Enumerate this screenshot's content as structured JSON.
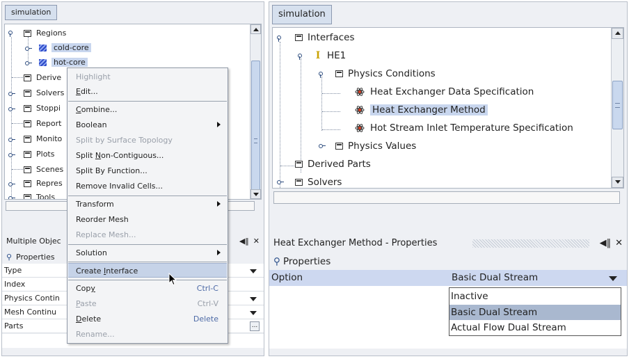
{
  "left": {
    "tab_label": "simulation",
    "tree": [
      {
        "label": "Regions",
        "icon": "folder-icon"
      },
      {
        "label": "cold-core",
        "icon": "region-icon"
      },
      {
        "label": "hot-core",
        "icon": "region-icon"
      },
      {
        "label": "Derive",
        "icon": "folder-icon"
      },
      {
        "label": "Solvers",
        "icon": "folder-icon"
      },
      {
        "label": "Stoppi",
        "icon": "folder-icon"
      },
      {
        "label": "Report",
        "icon": "folder-icon"
      },
      {
        "label": "Monito",
        "icon": "folder-icon"
      },
      {
        "label": "Plots",
        "icon": "folder-icon"
      },
      {
        "label": "Scenes",
        "icon": "folder-icon"
      },
      {
        "label": "Repres",
        "icon": "folder-icon"
      },
      {
        "label": "Tools",
        "icon": "folder-icon"
      }
    ],
    "props_title": "Multiple Objec",
    "props_header": "Properties",
    "props_rows": [
      "Type",
      "Index",
      "Physics Contin",
      "Mesh Continu",
      "Parts"
    ],
    "ellipsis": "..."
  },
  "context_menu": {
    "items": [
      {
        "label": "Highlight",
        "disabled": true
      },
      {
        "label": "Edit...",
        "mnemonic": "E"
      },
      {
        "label": "Combine...",
        "mnemonic": "C"
      },
      {
        "label": "Boolean",
        "submenu": true
      },
      {
        "label": "Split by Surface Topology",
        "disabled": true
      },
      {
        "label": "Split Non-Contiguous...",
        "mnemonic": "N"
      },
      {
        "label": "Split By Function..."
      },
      {
        "label": "Remove Invalid Cells..."
      },
      {
        "label": "Transform",
        "submenu": true
      },
      {
        "label": "Reorder Mesh"
      },
      {
        "label": "Replace Mesh...",
        "disabled": true
      },
      {
        "label": "Solution",
        "submenu": true
      },
      {
        "label": "Create Interface",
        "mnemonic": "I"
      },
      {
        "label": "Copy",
        "mnemonic": "y",
        "shortcut": "Ctrl-C"
      },
      {
        "label": "Paste",
        "mnemonic": "P",
        "shortcut": "Ctrl-V",
        "disabled": true
      },
      {
        "label": "Delete",
        "mnemonic": "D",
        "shortcut": "Delete"
      },
      {
        "label": "Rename...",
        "disabled": true
      }
    ]
  },
  "right": {
    "tab_label": "simulation",
    "tree": [
      {
        "label": "Interfaces",
        "icon": "folder-icon"
      },
      {
        "label": "HE1",
        "icon": "interface-icon"
      },
      {
        "label": "Physics Conditions",
        "icon": "folder-icon"
      },
      {
        "label": "Heat Exchanger Data Specification",
        "icon": "atom-icon"
      },
      {
        "label": "Heat Exchanger Method",
        "icon": "atom-icon"
      },
      {
        "label": "Hot Stream Inlet Temperature Specification",
        "icon": "atom-icon"
      },
      {
        "label": "Physics Values",
        "icon": "folder-icon"
      },
      {
        "label": "Derived Parts",
        "icon": "folder-icon"
      },
      {
        "label": "Solvers",
        "icon": "folder-icon"
      }
    ],
    "props_title": "Heat Exchanger Method - Properties",
    "props_header": "Properties",
    "option_label": "Option",
    "option_value": "Basic Dual Stream",
    "dropdown_options": [
      "Inactive",
      "Basic Dual Stream",
      "Actual Flow Dual Stream"
    ]
  },
  "controls": {
    "dock_glyph": "◀‖",
    "close_glyph": "✕"
  }
}
